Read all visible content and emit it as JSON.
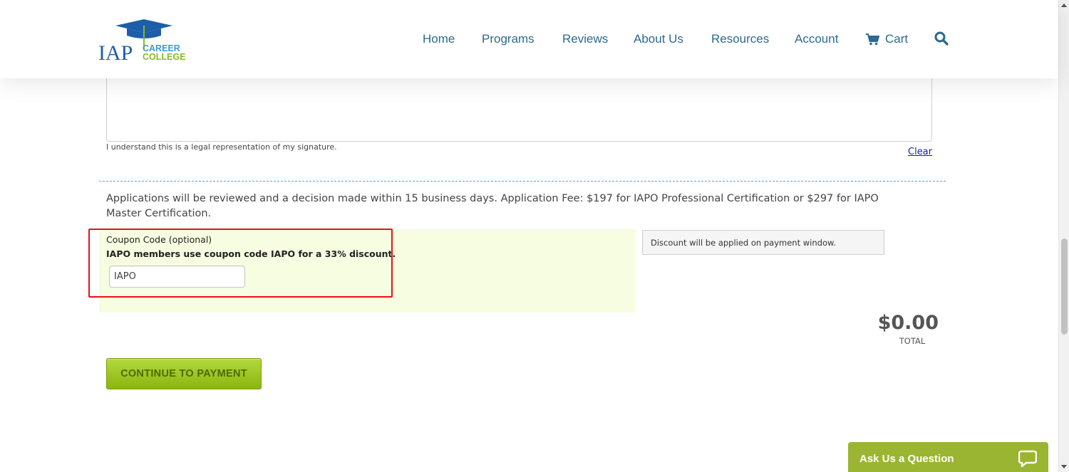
{
  "header": {
    "logo_text_main": "IAP",
    "logo_text_line1": "CAREER",
    "logo_text_line2": "COLLEGE",
    "nav": [
      "Home",
      "Programs",
      "Reviews",
      "About Us",
      "Resources",
      "Account",
      "Cart"
    ]
  },
  "signature": {
    "note": "I understand this is a legal representation of my signature.",
    "clear_label": "Clear"
  },
  "fee_text": "Applications will be reviewed and a decision made within 15 business days. Application Fee: $197 for IAPO Professional Certification or $297 for IAPO Master Certification.",
  "coupon": {
    "label": "Coupon Code (optional)",
    "hint": "IAPO members use coupon code IAPO for a 33% discount.",
    "value": "IAPO"
  },
  "discount_note": "Discount will be applied on payment window.",
  "total": {
    "amount": "$0.00",
    "label": "TOTAL"
  },
  "continue_label": "CONTINUE TO PAYMENT",
  "ask_widget_label": "Ask Us a Question",
  "colors": {
    "nav_text": "#2c6a8f",
    "accent_green": "#9ab531",
    "highlight_red": "#e8101a",
    "coupon_bg": "#f7fde0"
  },
  "icons": [
    "cart-icon",
    "search-icon",
    "chat-icon",
    "graduation-cap-icon"
  ]
}
